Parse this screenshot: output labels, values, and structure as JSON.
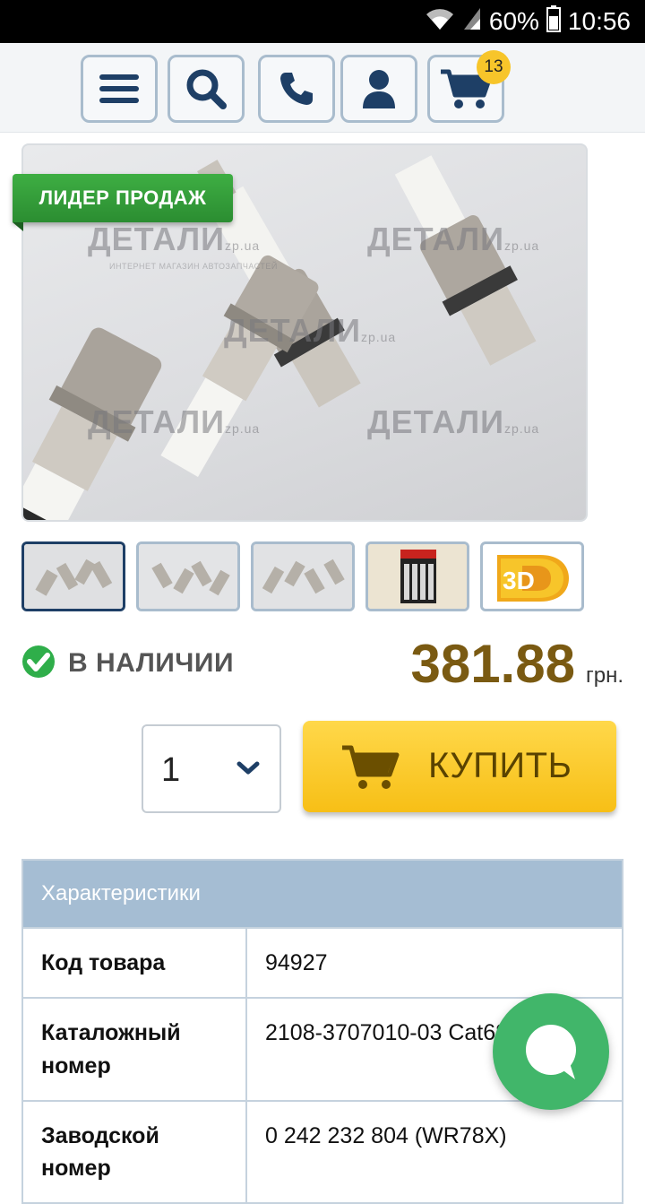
{
  "status_bar": {
    "battery": "60%",
    "time": "10:56"
  },
  "header": {
    "buttons": [
      "menu",
      "search",
      "phone",
      "account",
      "cart"
    ],
    "cart_count": "13"
  },
  "product": {
    "badge": "ЛИДЕР ПРОДАЖ",
    "watermark_brand": "ДЕТАЛИ",
    "watermark_domain": "zp.ua",
    "watermark_subtitle": "ИНТЕРНЕТ МАГАЗИН АВТОЗАПЧАСТЕЙ",
    "thumbnails": [
      "photo-1",
      "photo-2",
      "photo-3",
      "photo-4-box",
      "3d-view"
    ],
    "thumb_3d_label": "3D",
    "stock_status": "В НАЛИЧИИ",
    "price": "381.88",
    "currency": "грн.",
    "quantity": "1",
    "buy_label": "КУПИТЬ"
  },
  "specs": {
    "title": "Характеристики",
    "rows": [
      {
        "key": "Код товара",
        "value": "94927"
      },
      {
        "key": "Каталожный номер",
        "value": "2108-3707010-03 Cat686134"
      },
      {
        "key": "Заводской номер",
        "value": "0 242 232 804 (WR78X)"
      }
    ]
  },
  "colors": {
    "accent_blue": "#1e3f66",
    "buy_yellow": "#f7bf16",
    "stock_green": "#2fae4a",
    "price_brown": "#7a5a12",
    "chat_green": "#41b66a"
  }
}
